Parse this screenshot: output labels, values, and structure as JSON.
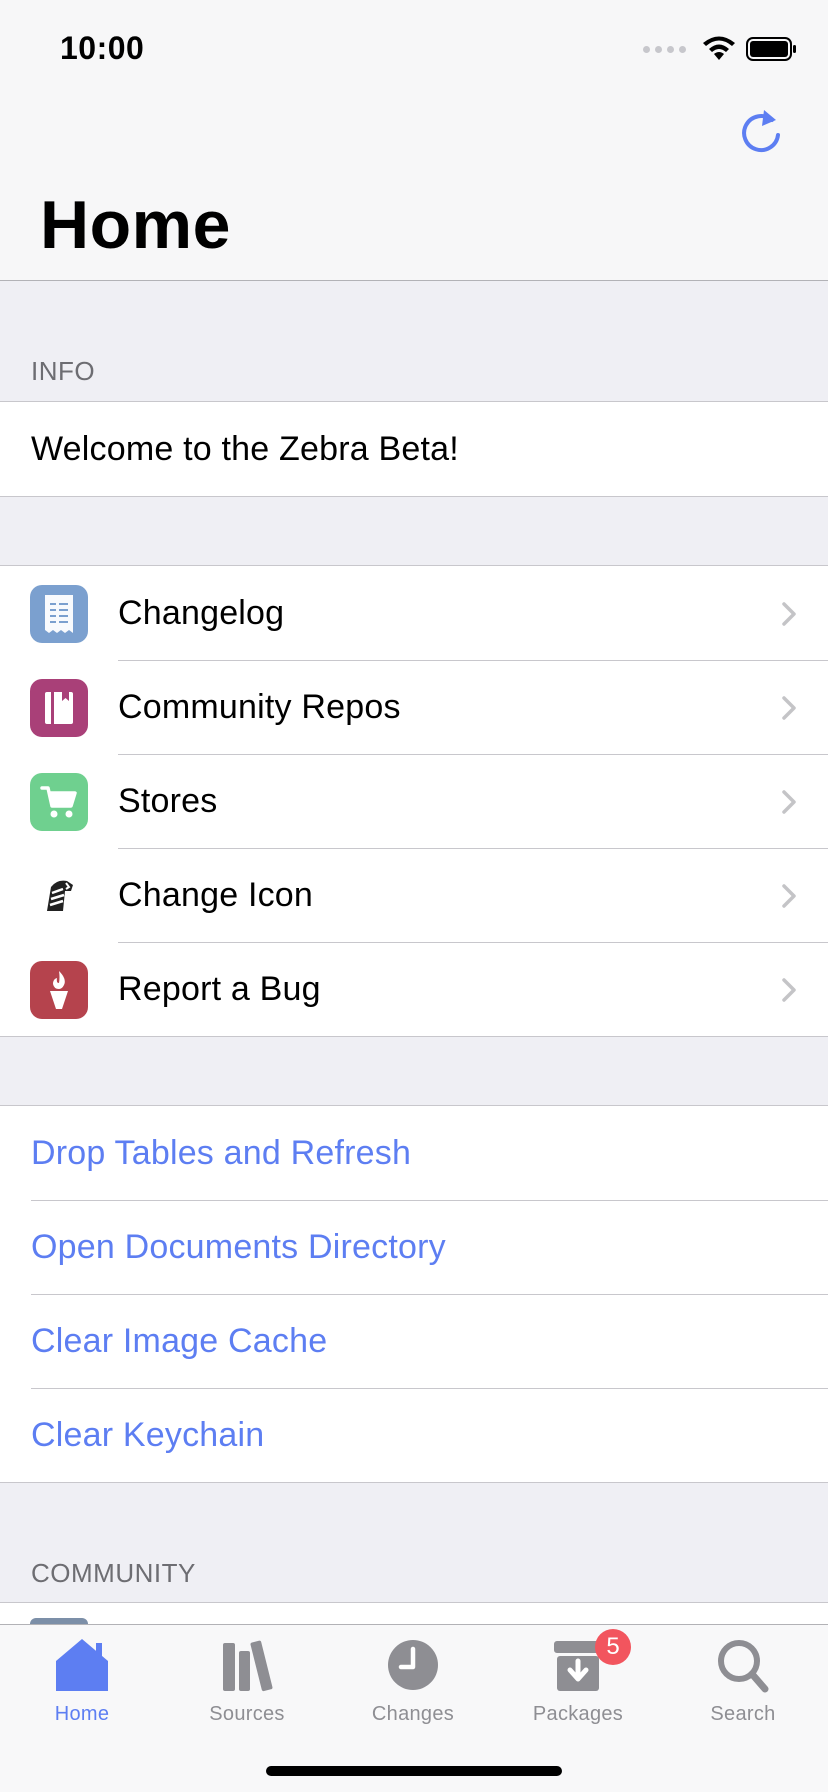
{
  "status_bar": {
    "time": "10:00"
  },
  "nav": {
    "title": "Home",
    "refresh_icon": "refresh-icon"
  },
  "info_section": {
    "header": "INFO",
    "message": "Welcome to the Zebra Beta!"
  },
  "menu": [
    {
      "label": "Changelog",
      "icon": "changelog-icon",
      "color": "#7ba0cf"
    },
    {
      "label": "Community Repos",
      "icon": "book-icon",
      "color": "#a94078"
    },
    {
      "label": "Stores",
      "icon": "cart-icon",
      "color": "#6fd08f"
    },
    {
      "label": "Change Icon",
      "icon": "zebra-icon",
      "color": "#ffffff"
    },
    {
      "label": "Report a Bug",
      "icon": "torch-icon",
      "color": "#b5434d"
    }
  ],
  "actions": [
    {
      "label": "Drop Tables and Refresh"
    },
    {
      "label": "Open Documents Directory"
    },
    {
      "label": "Clear Image Cache"
    },
    {
      "label": "Clear Keychain"
    }
  ],
  "community_section": {
    "header": "COMMUNITY"
  },
  "tabs": [
    {
      "label": "Home",
      "icon": "home-icon",
      "active": true
    },
    {
      "label": "Sources",
      "icon": "books-icon",
      "active": false
    },
    {
      "label": "Changes",
      "icon": "clock-icon",
      "active": false
    },
    {
      "label": "Packages",
      "icon": "package-icon",
      "active": false,
      "badge": "5"
    },
    {
      "label": "Search",
      "icon": "search-icon",
      "active": false
    }
  ],
  "colors": {
    "accent": "#5d7ef2",
    "badge": "#f2555e",
    "background": "#efeff4"
  }
}
